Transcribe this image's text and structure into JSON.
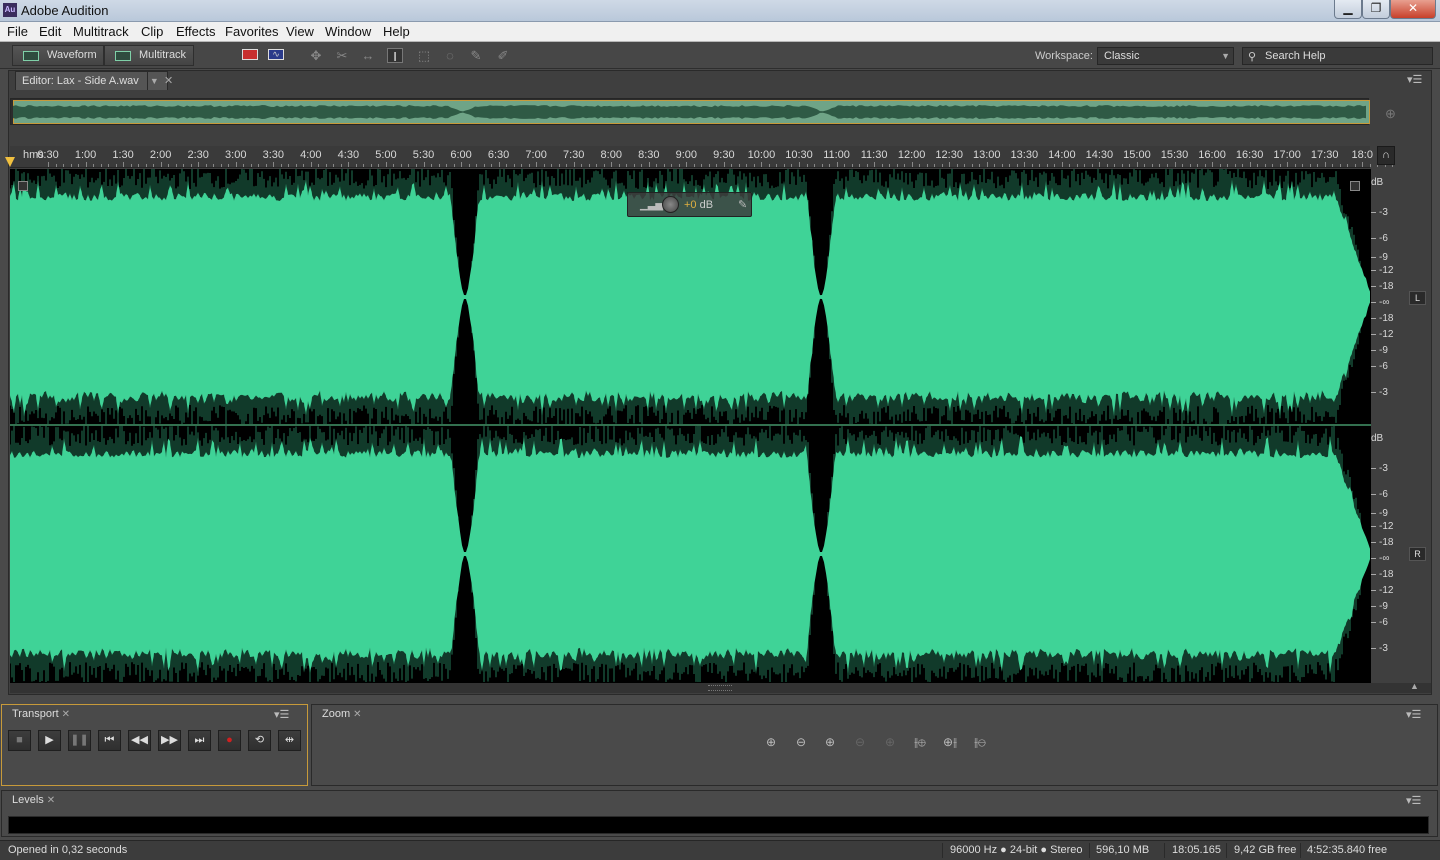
{
  "window": {
    "title": "Adobe Audition",
    "app_icon_text": "Au"
  },
  "menu": [
    "File",
    "Edit",
    "Multitrack",
    "Clip",
    "Effects",
    "Favorites",
    "View",
    "Window",
    "Help"
  ],
  "toolbar": {
    "waveform_label": "Waveform",
    "multitrack_label": "Multitrack",
    "workspace_label": "Workspace:",
    "workspace_value": "Classic",
    "search_placeholder": "Search Help",
    "tools": [
      "spectral-frequency-icon",
      "spectral-pitch-icon",
      "move-tool-icon",
      "razor-tool-icon",
      "slip-tool-icon",
      "time-selection-tool-icon",
      "marquee-tool-icon",
      "lasso-tool-icon",
      "brush-tool-icon",
      "spot-healing-tool-icon"
    ]
  },
  "editor": {
    "tab_label": "Editor: Lax - Side A.wav",
    "ruler_unit": "hms",
    "ruler_ticks": [
      "0:30",
      "1:00",
      "1:30",
      "2:00",
      "2:30",
      "3:00",
      "3:30",
      "4:00",
      "4:30",
      "5:00",
      "5:30",
      "6:00",
      "6:30",
      "7:00",
      "7:30",
      "8:00",
      "8:30",
      "9:00",
      "9:30",
      "10:00",
      "10:30",
      "11:00",
      "11:30",
      "12:00",
      "12:30",
      "13:00",
      "13:30",
      "14:00",
      "14:30",
      "15:00",
      "15:30",
      "16:00",
      "16:30",
      "17:00",
      "17:30",
      "18:0"
    ],
    "hud_value": "+0",
    "hud_unit": "dB",
    "db_scale": [
      "dB",
      "-3",
      "-6",
      "-9",
      "-12",
      "-18",
      "-∞",
      "-18",
      "-12",
      "-9",
      "-6",
      "-3"
    ],
    "channels": [
      "L",
      "R"
    ],
    "waveform_color": "#3fd397",
    "selection_color": "#c79a3a",
    "track_gaps_at_minutes": [
      6.0,
      10.8
    ],
    "duration_minutes": 18.08
  },
  "transport": {
    "label": "Transport",
    "buttons": [
      "stop-icon",
      "play-icon",
      "pause-icon",
      "go-to-start-icon",
      "rewind-icon",
      "fast-forward-icon",
      "go-to-end-icon",
      "record-icon",
      "loop-icon",
      "skip-selection-icon"
    ]
  },
  "zoom": {
    "label": "Zoom",
    "buttons": [
      "zoom-in-amplitude-icon",
      "zoom-out-amplitude-icon",
      "zoom-in-time-icon",
      "zoom-out-full-icon",
      "zoom-selection-icon",
      "zoom-in-left-icon",
      "zoom-in-right-icon",
      "zoom-out-both-icon"
    ]
  },
  "levels": {
    "label": "Levels"
  },
  "status": {
    "message": "Opened in 0,32 seconds",
    "format": "96000 Hz ● 24-bit ● Stereo",
    "size": "596,10 MB",
    "duration": "18:05.165",
    "disk_free": "9,42 GB free",
    "time_free": "4:52:35.840 free"
  }
}
